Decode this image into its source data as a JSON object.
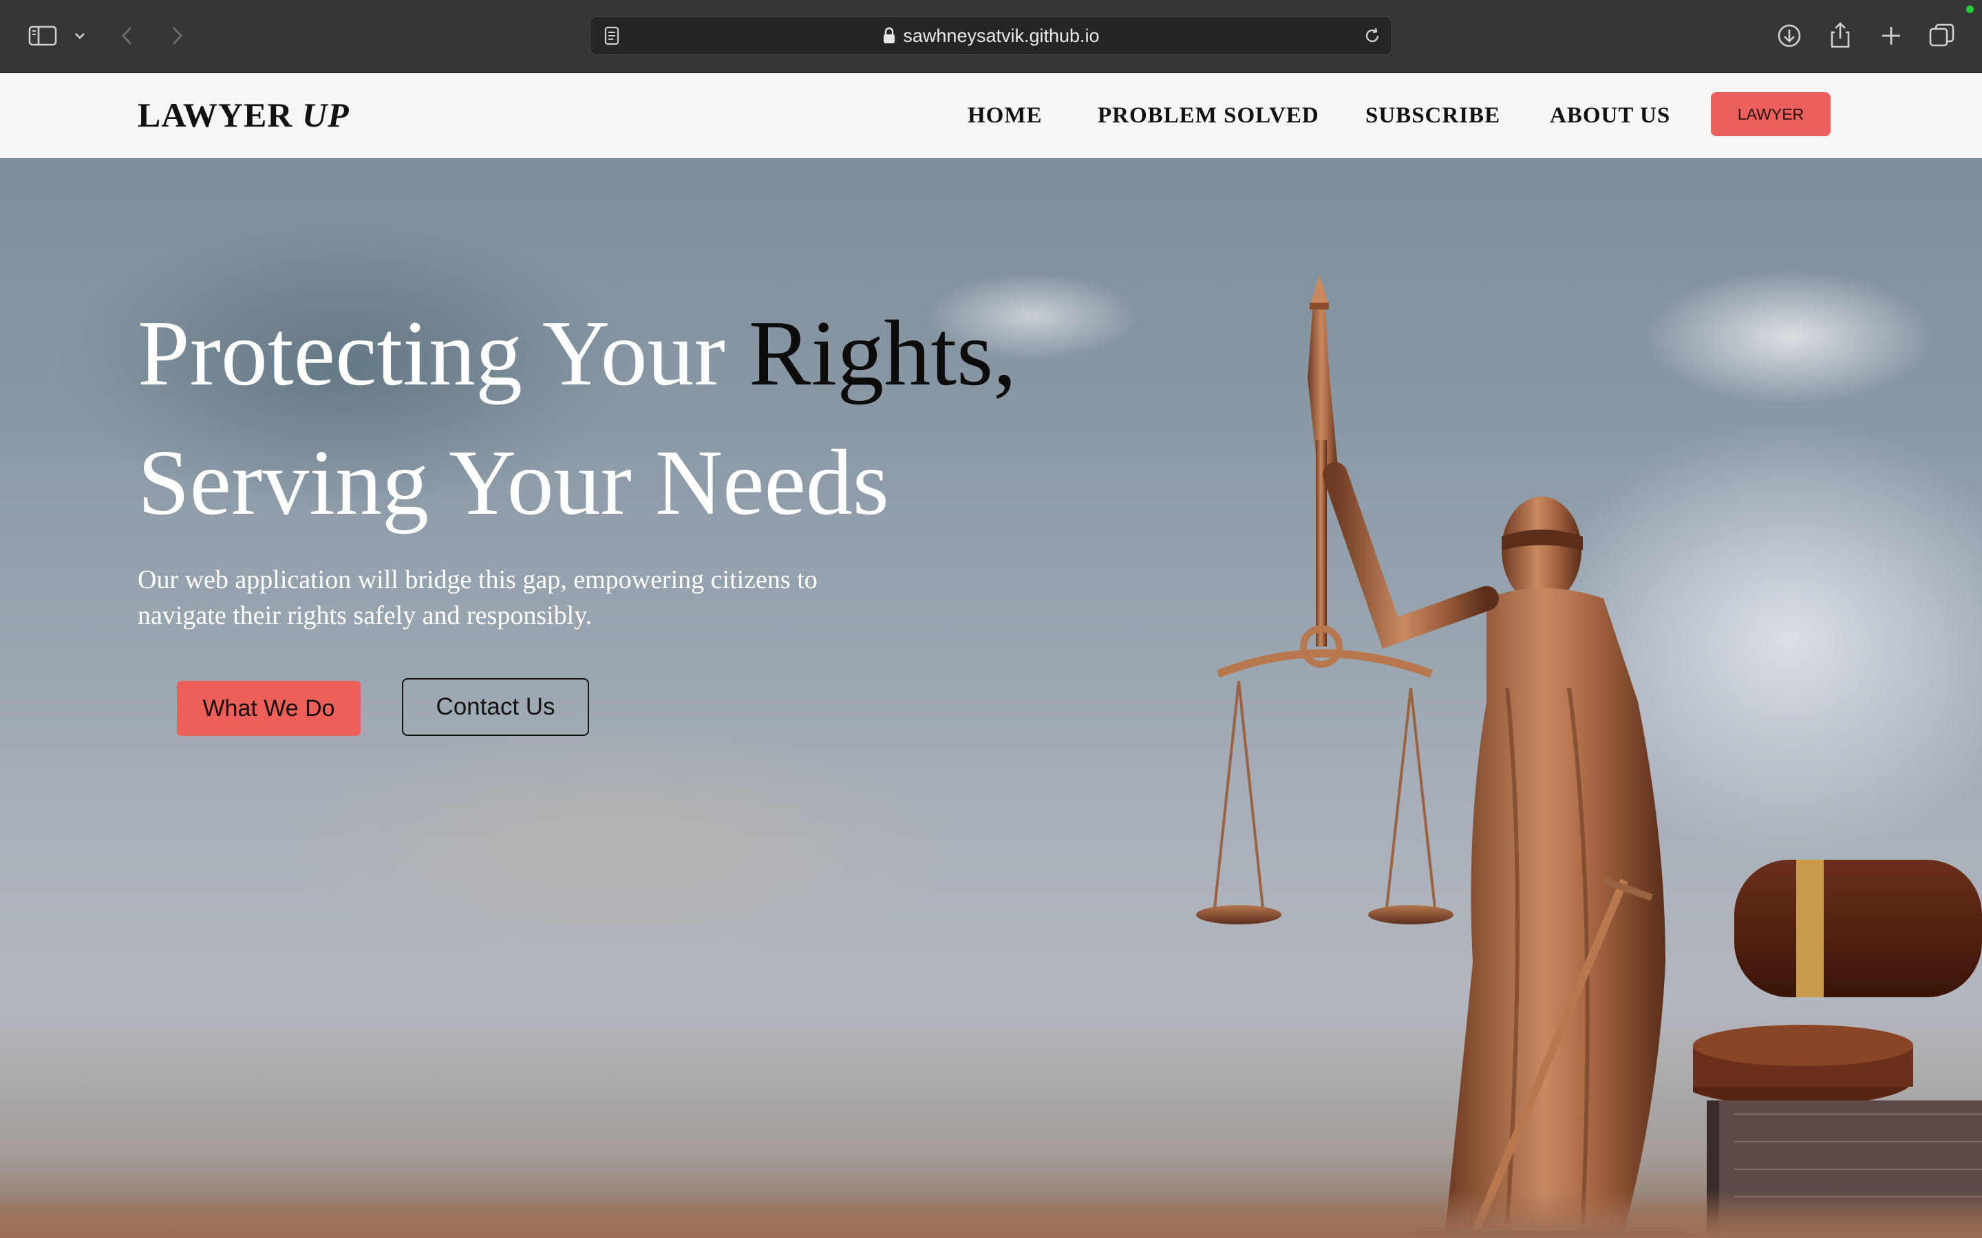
{
  "browser": {
    "url": "sawhneysatvik.github.io",
    "icons": [
      "sidebar-icon",
      "chevron-down-icon",
      "back-arrow-icon",
      "forward-arrow-icon",
      "reader-page-icon",
      "lock-icon",
      "reload-icon",
      "download-icon",
      "share-icon",
      "new-tab-plus-icon",
      "tab-overview-icon"
    ]
  },
  "navbar": {
    "logo_main": "LAWYER",
    "logo_accent": "UP",
    "links": [
      "HOME",
      "PROBLEM SOLVED",
      "SUBSCRIBE",
      "ABOUT US"
    ],
    "cta_label": "LAWYER",
    "cta_color": "#eb5f5c"
  },
  "hero": {
    "headline_part1": "Protecting Your",
    "headline_dark": "Rights,",
    "headline_line2": "Serving Your Needs",
    "subtext": "Our web application will bridge this gap, empowering citizens to navigate their rights safely and responsibly.",
    "primary_button": "What We Do",
    "secondary_button": "Contact Us",
    "accent_color": "#ec5f5b",
    "image": "lady-justice-statue-with-scales-and-gavel"
  }
}
